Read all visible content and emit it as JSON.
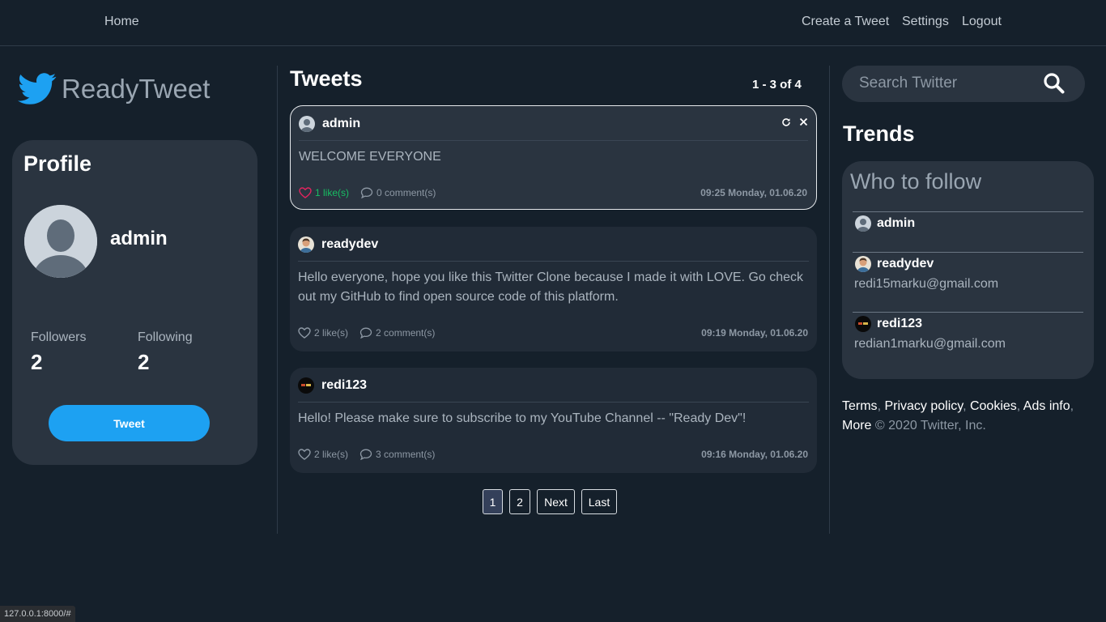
{
  "nav": {
    "home": "Home",
    "create_tweet": "Create a Tweet",
    "settings": "Settings",
    "logout": "Logout"
  },
  "brand": {
    "name": "ReadyTweet",
    "icon": "twitter-bird-icon",
    "color": "#1da1f2"
  },
  "profile": {
    "heading": "Profile",
    "username": "admin",
    "followers_label": "Followers",
    "followers_count": "2",
    "following_label": "Following",
    "following_count": "2",
    "tweet_button": "Tweet"
  },
  "feed": {
    "title": "Tweets",
    "count": "1 - 3 of 4",
    "tweets": [
      {
        "user": "admin",
        "text": "WELCOME EVERYONE",
        "likes": "1 like(s)",
        "comments": "0 comment(s)",
        "date": "09:25 Monday, 01.06.20",
        "liked": true
      },
      {
        "user": "readydev",
        "text": "Hello everyone, hope you like this Twitter Clone because I made it with LOVE. Go check out my GitHub to find open source code of this platform.",
        "likes": "2 like(s)",
        "comments": "2 comment(s)",
        "date": "09:19 Monday, 01.06.20",
        "liked": false
      },
      {
        "user": "redi123",
        "text": "Hello! Please make sure to subscribe to my YouTube Channel -- \"Ready Dev\"!",
        "likes": "2 like(s)",
        "comments": "3 comment(s)",
        "date": "09:16 Monday, 01.06.20",
        "liked": false
      }
    ]
  },
  "pagination": {
    "pages": [
      "1",
      "2"
    ],
    "next": "Next",
    "last": "Last",
    "current": "1"
  },
  "search": {
    "placeholder": "Search Twitter"
  },
  "trends": {
    "title": "Trends",
    "who_to_follow": "Who to follow",
    "users": [
      {
        "user": "admin",
        "email": ""
      },
      {
        "user": "readydev",
        "email": "redi15marku@gmail.com"
      },
      {
        "user": "redi123",
        "email": "redian1marku@gmail.com"
      }
    ]
  },
  "footer": {
    "terms": "Terms",
    "privacy": "Privacy policy",
    "cookies": "Cookies",
    "ads": "Ads info",
    "more": "More",
    "copyright": "© 2020 Twitter, Inc."
  },
  "statusbar": {
    "url": "127.0.0.1:8000/#"
  },
  "colors": {
    "background": "#15202b",
    "card": "#2a3440",
    "accent": "#1da1f2",
    "like_active": "#e0245e",
    "like_count_active": "#17bf63"
  }
}
